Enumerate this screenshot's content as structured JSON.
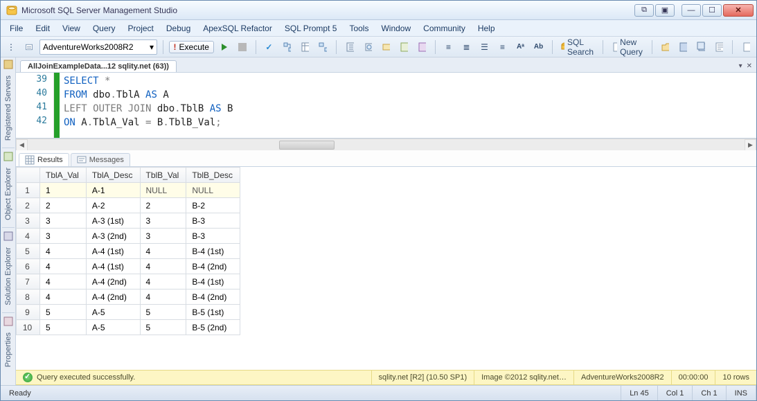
{
  "title": "Microsoft SQL Server Management Studio",
  "menu": [
    "File",
    "Edit",
    "View",
    "Query",
    "Project",
    "Debug",
    "ApexSQL Refactor",
    "SQL Prompt 5",
    "Tools",
    "Window",
    "Community",
    "Help"
  ],
  "toolbar": {
    "database": "AdventureWorks2008R2",
    "execute": "Execute",
    "sql_search": "SQL Search",
    "new_query": "New Query"
  },
  "side_tabs": [
    "Registered Servers",
    "Object Explorer",
    "Solution Explorer",
    "Properties"
  ],
  "document_tab": "AllJoinExampleData...12 sqlity.net (63))",
  "code": {
    "lines": [
      {
        "num": "39",
        "tokens": [
          {
            "t": "SELECT",
            "c": "kw-blue"
          },
          {
            "t": " ",
            "c": ""
          },
          {
            "t": "*",
            "c": "kw-grey"
          }
        ]
      },
      {
        "num": "40",
        "tokens": [
          {
            "t": "FROM",
            "c": "kw-blue"
          },
          {
            "t": " dbo",
            "c": "kw-dk"
          },
          {
            "t": ".",
            "c": "kw-grey"
          },
          {
            "t": "TblA ",
            "c": "kw-dk"
          },
          {
            "t": "AS",
            "c": "kw-blue"
          },
          {
            "t": " A",
            "c": "kw-dk"
          }
        ]
      },
      {
        "num": "41",
        "tokens": [
          {
            "t": "LEFT OUTER JOIN",
            "c": "kw-grey"
          },
          {
            "t": " dbo",
            "c": "kw-dk"
          },
          {
            "t": ".",
            "c": "kw-grey"
          },
          {
            "t": "TblB ",
            "c": "kw-dk"
          },
          {
            "t": "AS",
            "c": "kw-blue"
          },
          {
            "t": " B",
            "c": "kw-dk"
          }
        ]
      },
      {
        "num": "42",
        "tokens": [
          {
            "t": "ON",
            "c": "kw-blue"
          },
          {
            "t": " A",
            "c": "kw-dk"
          },
          {
            "t": ".",
            "c": "kw-grey"
          },
          {
            "t": "TblA_Val ",
            "c": "kw-dk"
          },
          {
            "t": "=",
            "c": "kw-grey"
          },
          {
            "t": " B",
            "c": "kw-dk"
          },
          {
            "t": ".",
            "c": "kw-grey"
          },
          {
            "t": "TblB_Val",
            "c": "kw-dk"
          },
          {
            "t": ";",
            "c": "kw-grey"
          }
        ]
      }
    ]
  },
  "results_tabs": {
    "results": "Results",
    "messages": "Messages"
  },
  "grid": {
    "columns": [
      "TblA_Val",
      "TblA_Desc",
      "TblB_Val",
      "TblB_Desc"
    ],
    "rows": [
      [
        "1",
        "A-1",
        "NULL",
        "NULL"
      ],
      [
        "2",
        "A-2",
        "2",
        "B-2"
      ],
      [
        "3",
        "A-3 (1st)",
        "3",
        "B-3"
      ],
      [
        "3",
        "A-3 (2nd)",
        "3",
        "B-3"
      ],
      [
        "4",
        "A-4 (1st)",
        "4",
        "B-4 (1st)"
      ],
      [
        "4",
        "A-4 (1st)",
        "4",
        "B-4 (2nd)"
      ],
      [
        "4",
        "A-4 (2nd)",
        "4",
        "B-4 (1st)"
      ],
      [
        "4",
        "A-4 (2nd)",
        "4",
        "B-4 (2nd)"
      ],
      [
        "5",
        "A-5",
        "5",
        "B-5 (1st)"
      ],
      [
        "5",
        "A-5",
        "5",
        "B-5 (2nd)"
      ]
    ]
  },
  "msgbar": {
    "status": "Query executed successfully.",
    "server": "sqlity.net [R2] (10.50 SP1)",
    "image": "Image ©2012 sqlity.net…",
    "db": "AdventureWorks2008R2",
    "time": "00:00:00",
    "rows": "10 rows"
  },
  "statusbar": {
    "ready": "Ready",
    "ln": "Ln 45",
    "col": "Col 1",
    "ch": "Ch 1",
    "ins": "INS"
  }
}
